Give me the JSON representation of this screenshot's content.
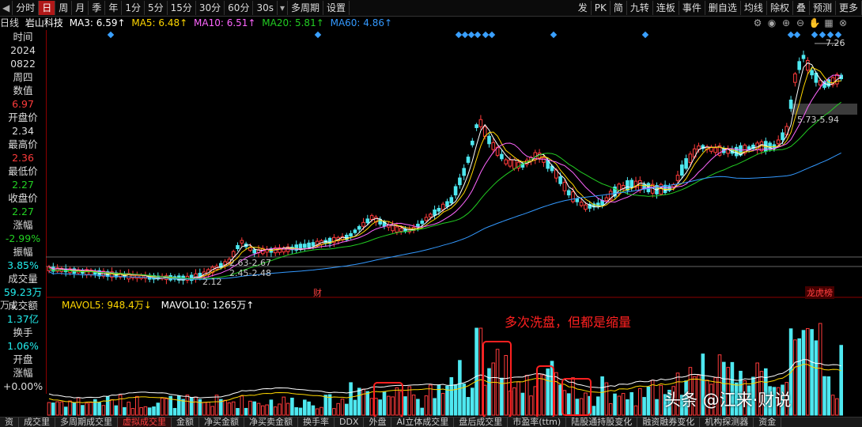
{
  "toolbar": {
    "left": [
      "分时",
      "日",
      "周",
      "月",
      "季",
      "年",
      "1分",
      "5分",
      "15分",
      "30分",
      "60分",
      "30s"
    ],
    "active_index": 1,
    "multi_period": "多周期",
    "settings": "设置",
    "right": [
      "发",
      "PK",
      "简",
      "九转",
      "连板",
      "事件",
      "删自选",
      "均线",
      "除权",
      "叠",
      "预测",
      "更多"
    ]
  },
  "indicator_line": {
    "period": "日线",
    "stock_name": "岩山科技",
    "ma3": "MA3: 6.59↑",
    "ma5": "MA5: 6.48↑",
    "ma10": "MA10: 6.51↑",
    "ma20": "MA20: 5.81↑",
    "ma60": "MA60: 4.86↑"
  },
  "sidebar": {
    "time_label": "时间",
    "year": "2024",
    "date": "0822",
    "weekday": "周四",
    "value_label": "数值",
    "value": "6.97",
    "open_label": "开盘价",
    "open": "2.34",
    "high_label": "最高价",
    "high": "2.36",
    "low_label": "最低价",
    "low": "2.27",
    "close_label": "收盘价",
    "close": "2.27",
    "change_label": "涨幅",
    "change": "-2.99%",
    "amplitude_label": "振幅",
    "amplitude": "3.85%",
    "volume_label": "成交量",
    "volume": "59.23万",
    "amount_label": "成交额",
    "amount": "1.37亿",
    "turnover_label": "换手",
    "turnover": "1.06%",
    "open2_label": "开盘",
    "open2_change_label": "涨幅",
    "open2_change": "+0.00%"
  },
  "chart_labels": {
    "high_price": "7.26",
    "range_top": "5.73-5.94",
    "range_mid": "2.63-2.67",
    "range_low": "2.45-2.48",
    "low_price": "2.12",
    "event_cai": "财",
    "event_bang": "龙虎榜"
  },
  "volume_line": {
    "prefix": "万↓",
    "mavol5": "MAVOL5: 948.4万↓",
    "mavol10": "MAVOL10: 1265万↑"
  },
  "annotation": "多次洗盘，但都是缩量",
  "bottom_tabs": [
    "资",
    "成交里",
    "多周期成交里",
    "虚拟成交里",
    "金额",
    "净买金额",
    "净买卖金额",
    "换手率",
    "DDX",
    "外盘",
    "AI立体成交里",
    "盘后成交里",
    "市盈率(ttm)",
    "陆股通持股变化",
    "融资融券变化",
    "机构探测器",
    "资金"
  ],
  "bottom_active_index": 3,
  "watermark": "头条 @江来·财说",
  "colors": {
    "up": "#ff3b3b",
    "down": "#4ee8f0",
    "ma3": "#ffffff",
    "ma5": "#ffd700",
    "ma10": "#ff66ff",
    "ma20": "#22cc22",
    "ma60": "#3399ff",
    "annotation": "#ff2020"
  }
}
